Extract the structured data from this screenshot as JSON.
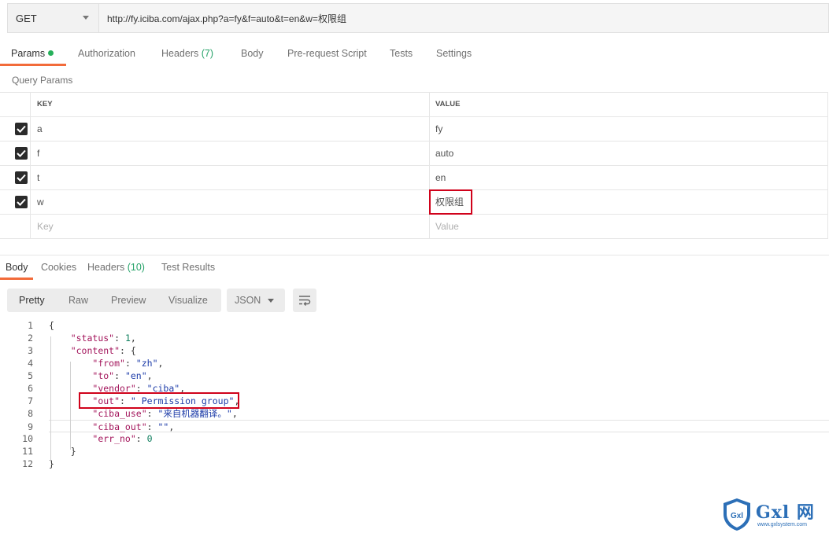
{
  "request": {
    "method": "GET",
    "url": "http://fy.iciba.com/ajax.php?a=fy&f=auto&t=en&w=权限组"
  },
  "request_tabs": [
    {
      "label": "Params",
      "count": "",
      "active": true
    },
    {
      "label": "Authorization",
      "count": ""
    },
    {
      "label": "Headers",
      "count": "(7)"
    },
    {
      "label": "Body",
      "count": ""
    },
    {
      "label": "Pre-request Script",
      "count": ""
    },
    {
      "label": "Tests",
      "count": ""
    },
    {
      "label": "Settings",
      "count": ""
    }
  ],
  "params": {
    "section_label": "Query Params",
    "columns": {
      "key": "KEY",
      "value": "VALUE"
    },
    "rows": [
      {
        "key": "a",
        "value": "fy",
        "checked": true
      },
      {
        "key": "f",
        "value": "auto",
        "checked": true
      },
      {
        "key": "t",
        "value": "en",
        "checked": true
      },
      {
        "key": "w",
        "value": "权限组",
        "checked": true
      }
    ],
    "placeholder": {
      "key": "Key",
      "value": "Value"
    }
  },
  "response_tabs": [
    {
      "label": "Body",
      "count": "",
      "active": true
    },
    {
      "label": "Cookies",
      "count": ""
    },
    {
      "label": "Headers",
      "count": "(10)"
    },
    {
      "label": "Test Results",
      "count": ""
    }
  ],
  "toolbar": {
    "views": [
      "Pretty",
      "Raw",
      "Preview",
      "Visualize"
    ],
    "format": "JSON",
    "wrap_icon": "wrap-lines-icon"
  },
  "code": {
    "line_numbers": [
      "1",
      "2",
      "3",
      "4",
      "5",
      "6",
      "7",
      "8",
      "9",
      "10",
      "11",
      "12"
    ],
    "lines": [
      {
        "indent": "",
        "parts": [
          {
            "t": "{",
            "c": "p"
          }
        ]
      },
      {
        "indent": "    ",
        "parts": [
          {
            "t": "\"status\"",
            "c": "key"
          },
          {
            "t": ": ",
            "c": "p"
          },
          {
            "t": "1",
            "c": "num"
          },
          {
            "t": ",",
            "c": "p"
          }
        ]
      },
      {
        "indent": "    ",
        "parts": [
          {
            "t": "\"content\"",
            "c": "key"
          },
          {
            "t": ": {",
            "c": "p"
          }
        ]
      },
      {
        "indent": "        ",
        "parts": [
          {
            "t": "\"from\"",
            "c": "key"
          },
          {
            "t": ": ",
            "c": "p"
          },
          {
            "t": "\"zh\"",
            "c": "str"
          },
          {
            "t": ",",
            "c": "p"
          }
        ]
      },
      {
        "indent": "        ",
        "parts": [
          {
            "t": "\"to\"",
            "c": "key"
          },
          {
            "t": ": ",
            "c": "p"
          },
          {
            "t": "\"en\"",
            "c": "str"
          },
          {
            "t": ",",
            "c": "p"
          }
        ]
      },
      {
        "indent": "        ",
        "parts": [
          {
            "t": "\"vendor\"",
            "c": "key"
          },
          {
            "t": ": ",
            "c": "p"
          },
          {
            "t": "\"ciba\"",
            "c": "str"
          },
          {
            "t": ",",
            "c": "p"
          }
        ]
      },
      {
        "indent": "        ",
        "parts": [
          {
            "t": "\"out\"",
            "c": "key"
          },
          {
            "t": ": ",
            "c": "p"
          },
          {
            "t": "\" Permission group\"",
            "c": "str"
          },
          {
            "t": ",",
            "c": "p"
          }
        ]
      },
      {
        "indent": "        ",
        "parts": [
          {
            "t": "\"ciba_use\"",
            "c": "key"
          },
          {
            "t": ": ",
            "c": "p"
          },
          {
            "t": "\"来自机器翻译。\"",
            "c": "str"
          },
          {
            "t": ",",
            "c": "p"
          }
        ]
      },
      {
        "indent": "        ",
        "parts": [
          {
            "t": "\"ciba_out\"",
            "c": "key"
          },
          {
            "t": ": ",
            "c": "p"
          },
          {
            "t": "\"\"",
            "c": "str"
          },
          {
            "t": ",",
            "c": "p"
          }
        ]
      },
      {
        "indent": "        ",
        "parts": [
          {
            "t": "\"err_no\"",
            "c": "key"
          },
          {
            "t": ": ",
            "c": "p"
          },
          {
            "t": "0",
            "c": "num"
          }
        ]
      },
      {
        "indent": "    ",
        "parts": [
          {
            "t": "}",
            "c": "p"
          }
        ]
      },
      {
        "indent": "",
        "parts": [
          {
            "t": "}",
            "c": "p"
          }
        ]
      }
    ]
  },
  "watermark": {
    "text": "Gxl 网",
    "url": "www.gxlsystem.com",
    "badge": "Gxl"
  },
  "colors": {
    "accent": "#f26b3a",
    "active_dot": "#26b05a",
    "highlight": "#d0021b"
  }
}
